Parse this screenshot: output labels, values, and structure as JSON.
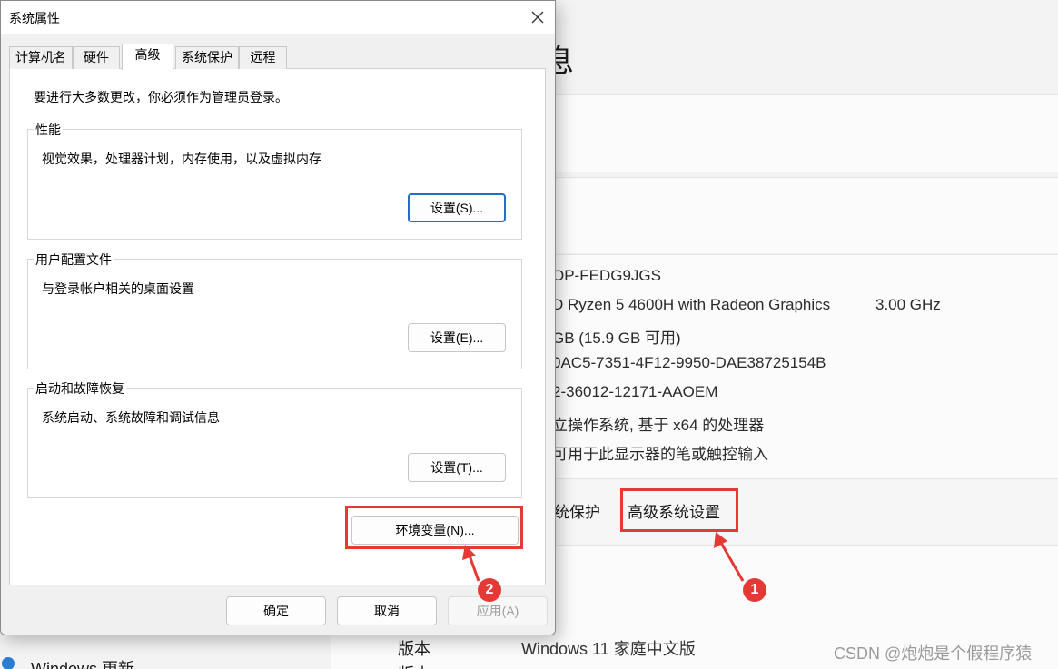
{
  "background": {
    "page_title": "息",
    "specs": [
      "OP-FEDG9JGS",
      "D Ryzen 5 4600H with Radeon Graphics",
      "GB (15.9 GB 可用)",
      "0AC5-7351-4F12-9950-DAE38725154B",
      "2-36012-12171-AAOEM",
      "立操作系统, 基于 x64 的处理器",
      "可用于此显示器的笔或触控输入"
    ],
    "cpu_speed": "3.00 GHz",
    "links": {
      "system_protection": "统保护",
      "advanced_settings": "高级系统设置"
    },
    "edition_label": "版本",
    "edition_value": "Windows 11 家庭中文版",
    "next_label": "版本",
    "nav_item": "Windows 更新"
  },
  "dialog": {
    "title": "系统属性",
    "tabs": [
      {
        "label": "计算机名"
      },
      {
        "label": "硬件"
      },
      {
        "label": "高级"
      },
      {
        "label": "系统保护"
      },
      {
        "label": "远程"
      }
    ],
    "active_tab": "高级",
    "admin_note": "要进行大多数更改，你必须作为管理员登录。",
    "groups": {
      "performance": {
        "title": "性能",
        "desc": "视觉效果，处理器计划，内存使用，以及虚拟内存",
        "button": "设置(S)..."
      },
      "user_profiles": {
        "title": "用户配置文件",
        "desc": "与登录帐户相关的桌面设置",
        "button": "设置(E)..."
      },
      "startup": {
        "title": "启动和故障恢复",
        "desc": "系统启动、系统故障和调试信息",
        "button": "设置(T)..."
      }
    },
    "env_button": "环境变量(N)...",
    "ok_button": "确定",
    "cancel_button": "取消",
    "apply_button": "应用(A)"
  },
  "annotations": {
    "badge1": "1",
    "badge2": "2",
    "color": "#e53935"
  },
  "watermark": "CSDN @炮炮是个假程序猿"
}
